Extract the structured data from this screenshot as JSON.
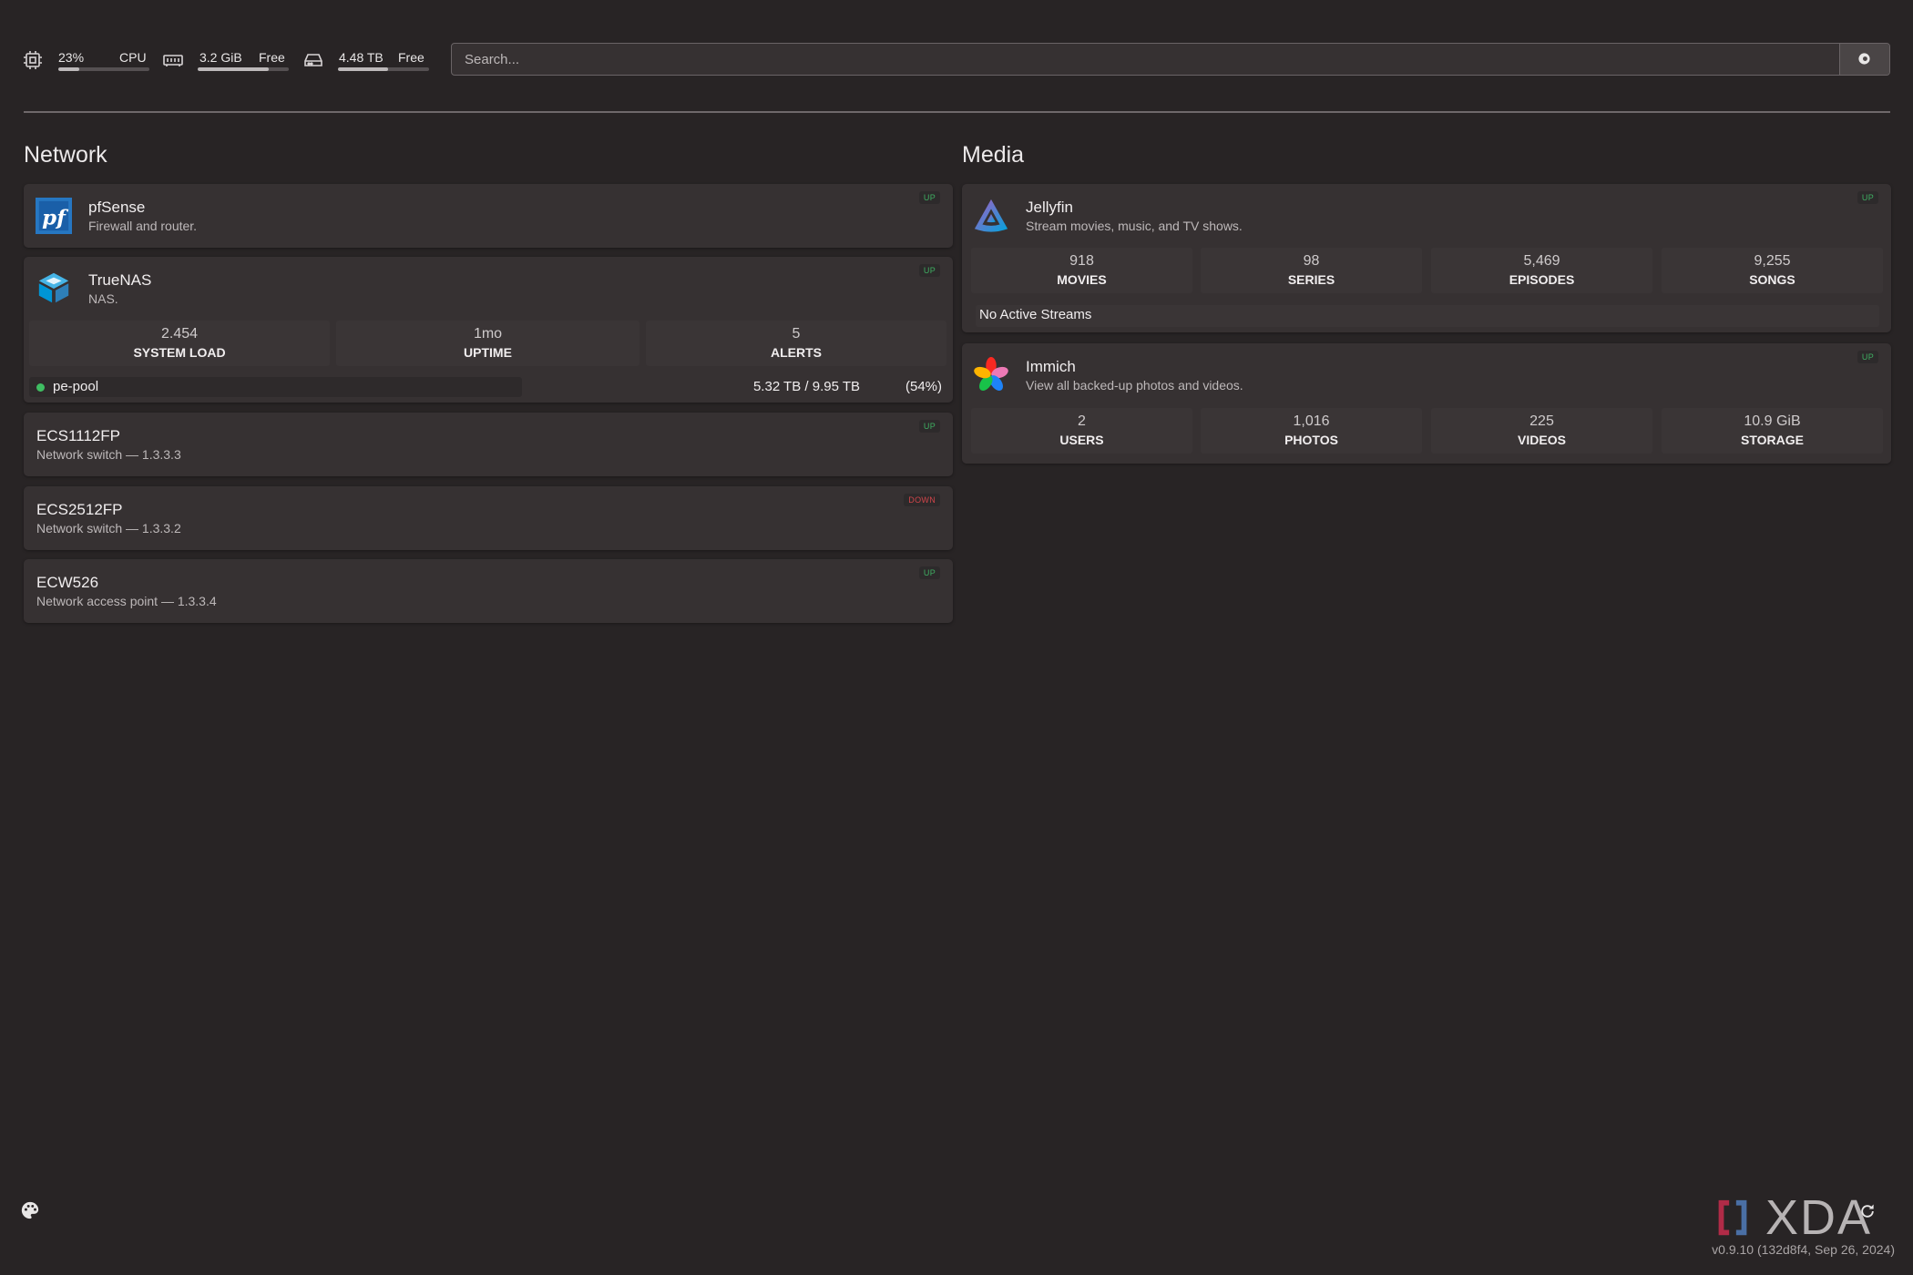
{
  "header": {
    "resources": {
      "cpu": {
        "value": "23%",
        "label": "CPU",
        "level": 0.23
      },
      "memory": {
        "value": "3.2 GiB",
        "label": "Free",
        "level": 0.78
      },
      "disk": {
        "value": "4.48 TB",
        "label": "Free",
        "level": 0.55
      }
    },
    "search": {
      "placeholder": "Search..."
    }
  },
  "groups": [
    {
      "title": "Network",
      "services": [
        {
          "name": "pfSense",
          "description": "Firewall and router.",
          "status": "UP"
        },
        {
          "name": "TrueNAS",
          "description": "NAS.",
          "status": "UP",
          "stats": [
            {
              "value": "2.454",
              "label": "SYSTEM LOAD"
            },
            {
              "value": "1mo",
              "label": "UPTIME"
            },
            {
              "value": "5",
              "label": "ALERTS"
            }
          ],
          "pool": {
            "name": "pe-pool",
            "used": "5.32 TB / 9.95 TB",
            "percent": "(54%)",
            "level": 0.54
          }
        },
        {
          "name": "ECS1112FP",
          "description": "Network switch — 1.3.3.3",
          "status": "UP"
        },
        {
          "name": "ECS2512FP",
          "description": "Network switch — 1.3.3.2",
          "status": "DOWN"
        },
        {
          "name": "ECW526",
          "description": "Network access point — 1.3.3.4",
          "status": "UP"
        }
      ]
    },
    {
      "title": "Media",
      "services": [
        {
          "name": "Jellyfin",
          "description": "Stream movies, music, and TV shows.",
          "status": "UP",
          "stats": [
            {
              "value": "918",
              "label": "MOVIES"
            },
            {
              "value": "98",
              "label": "SERIES"
            },
            {
              "value": "5,469",
              "label": "EPISODES"
            },
            {
              "value": "9,255",
              "label": "SONGS"
            }
          ],
          "streams": "No Active Streams"
        },
        {
          "name": "Immich",
          "description": "View all backed-up photos and videos.",
          "status": "UP",
          "stats": [
            {
              "value": "2",
              "label": "USERS"
            },
            {
              "value": "1,016",
              "label": "PHOTOS"
            },
            {
              "value": "225",
              "label": "VIDEOS"
            },
            {
              "value": "10.9 GiB",
              "label": "STORAGE"
            }
          ]
        }
      ]
    }
  ],
  "footer": {
    "version": "v0.9.10 (132d8f4, Sep 26, 2024)",
    "watermark": "XDA"
  },
  "icons": {
    "cpu": "cpu-chip-icon",
    "memory": "memory-icon",
    "disk": "hard-drive-icon",
    "search_button": "search-engine-icon",
    "theme": "palette-icon",
    "refresh": "refresh-icon"
  },
  "colors": {
    "background": "#282425",
    "card": "#363132",
    "up": "#3fae62",
    "down": "#d0454a"
  }
}
